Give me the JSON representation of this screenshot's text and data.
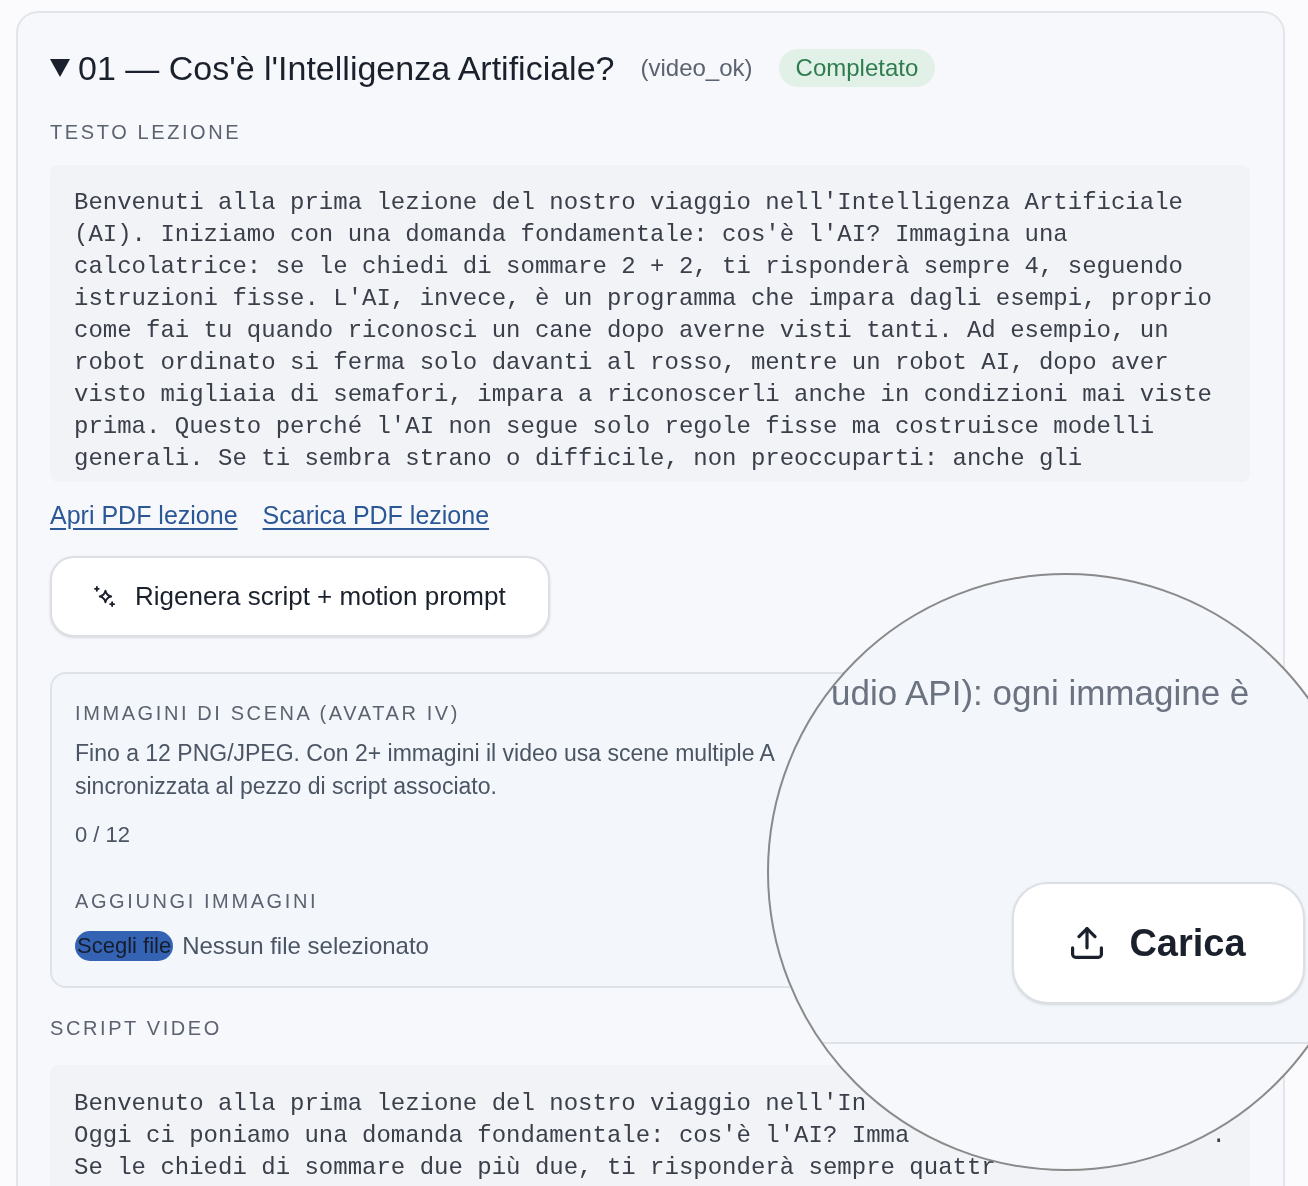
{
  "lesson": {
    "expanded": true,
    "title": "01 — Cos'è l'Intelligenza Artificiale?",
    "status_code": "(video_ok)",
    "status_badge": "Completato"
  },
  "lesson_text": {
    "label": "TESTO LEZIONE",
    "text": "Benvenuti alla prima lezione del nostro viaggio nell'Intelligenza Artificiale (AI). Iniziamo con una domanda fondamentale: cos'è l'AI? Immagina una calcolatrice: se le chiedi di sommare 2 + 2, ti risponderà sempre 4, seguendo istruzioni fisse. L'AI, invece, è un programma che impara dagli esempi, proprio come fai tu quando riconosci un cane dopo averne visti tanti. Ad esempio, un robot ordinato si ferma solo davanti al rosso, mentre un robot AI, dopo aver visto migliaia di semafori, impara a riconoscerli anche in condizioni mai viste prima. Questo perché l'AI non segue solo regole fisse ma costruisce modelli generali. Se ti sembra strano o difficile, non preoccuparti: anche gli"
  },
  "pdf_links": [
    "Apri PDF lezione",
    "Scarica PDF lezione"
  ],
  "regenerate_button": {
    "label": "Rigenera script + motion prompt"
  },
  "scene_images": {
    "title": "IMMAGINI DI SCENA (AVATAR IV)",
    "description_lines": [
      "Fino a 12 PNG/JPEG. Con 2+ immagini il video usa scene multiple A",
      "sincronizzata al pezzo di script associato."
    ],
    "counter": "0 / 12",
    "add_label": "AGGIUNGI IMMAGINI",
    "file_input": {
      "button": "Scegli file",
      "status": "Nessun file selezionato"
    }
  },
  "script_video": {
    "label": "SCRIPT VIDEO",
    "lines": [
      {
        "text": "Benvenuto alla prima lezione del nostro viaggio nell'In"
      },
      {
        "text": "Oggi ci poniamo una domanda fondamentale: cos'è l'AI? Imma",
        "end": "."
      },
      {
        "text": "Se le chiedi di sommare due più due, ti risponderà sempre quattr"
      }
    ]
  },
  "magnifier": {
    "text": "udio API): ogni immagine è",
    "button": "Carica"
  }
}
